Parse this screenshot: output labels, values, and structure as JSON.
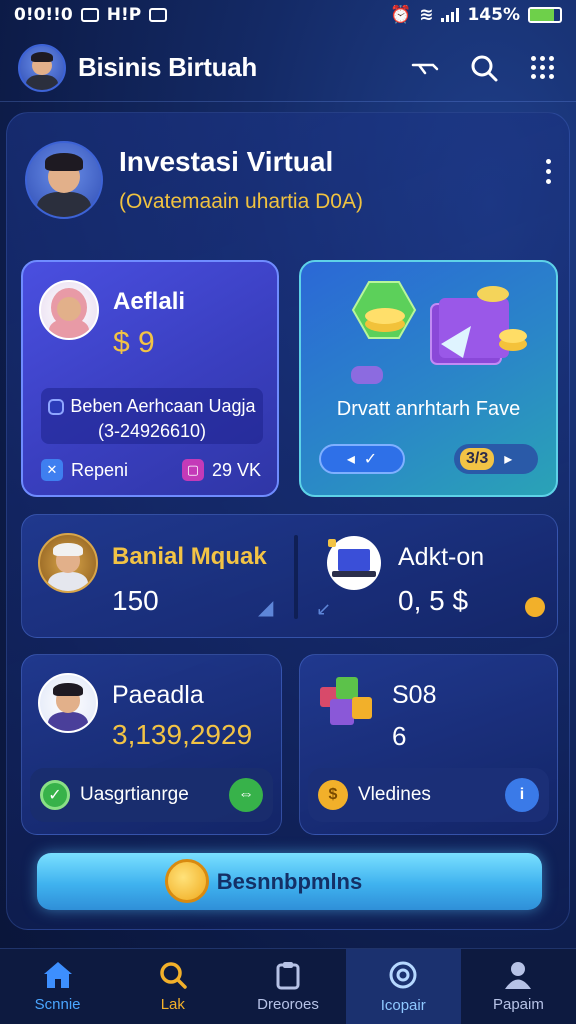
{
  "status_bar": {
    "time": "0!0!!0",
    "network": "H!P",
    "battery": "145%",
    "battery_level": 0.8
  },
  "app_bar": {
    "title": "Bisinis Birtuah",
    "avatar_icon": "user-avatar-icon"
  },
  "hero": {
    "title": "Investasi Virtual",
    "subtitle": "(Ovatemaain uhartia D0A)"
  },
  "card_user": {
    "name": "Aeflali",
    "amount": "$ 9",
    "sub_line1": "Beben Aerhcaan Uagja",
    "sub_line2": "(3-24926610)",
    "left_tag": "Repeni",
    "right_tag": "29 VK"
  },
  "card_promo": {
    "label": "Drvatt anrhtarh Fave",
    "pill_right": "3/3"
  },
  "card_row": {
    "left_name": "Banial Mquak",
    "left_value": "150",
    "right_name": "Adkt-on",
    "right_value": "0, 5 $"
  },
  "card_d": {
    "name": "Paeadla",
    "value": "3,139,2929",
    "row_label": "Uasgrtianrge"
  },
  "card_e": {
    "name": "S08",
    "value": "6",
    "row_label": "Vledines"
  },
  "cta": {
    "label": "Besnnbpmlns"
  },
  "bottom_nav": [
    {
      "label": "Scnnie",
      "icon": "home-icon"
    },
    {
      "label": "Lak",
      "icon": "search-icon"
    },
    {
      "label": "Dreoroes",
      "icon": "clipboard-icon"
    },
    {
      "label": "Icopair",
      "icon": "at-sign-icon"
    },
    {
      "label": "Papaim",
      "icon": "profile-icon"
    }
  ]
}
